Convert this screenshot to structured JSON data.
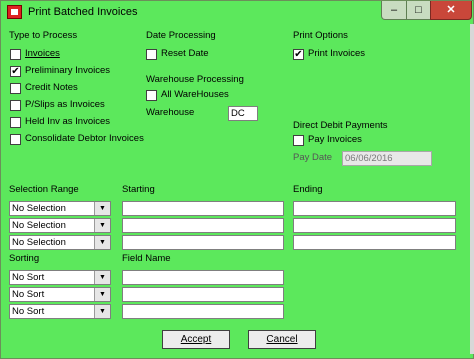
{
  "window": {
    "title": "Print Batched Invoices",
    "minimize_glyph": "–",
    "maximize_glyph": "□",
    "close_glyph": "✕"
  },
  "type_to_process": {
    "header": "Type to Process",
    "items": [
      {
        "label": "Invoices",
        "checked": false
      },
      {
        "label": "Preliminary Invoices",
        "checked": true
      },
      {
        "label": "Credit Notes",
        "checked": false
      },
      {
        "label": "P/Slips as Invoices",
        "checked": false
      },
      {
        "label": "Held Inv as Invoices",
        "checked": false
      },
      {
        "label": "Consolidate Debtor Invoices",
        "checked": false
      }
    ]
  },
  "date_processing": {
    "header": "Date Processing",
    "reset_date": {
      "label": "Reset Date",
      "checked": false
    }
  },
  "warehouse_processing": {
    "header": "Warehouse Processing",
    "all_warehouses": {
      "label": "All WareHouses",
      "checked": false
    },
    "warehouse_label": "Warehouse",
    "warehouse_value": "DC"
  },
  "print_options": {
    "header": "Print Options",
    "print_invoices": {
      "label": "Print Invoices",
      "checked": true
    }
  },
  "direct_debit": {
    "header": "Direct Debit Payments",
    "pay_invoices": {
      "label": "Pay Invoices",
      "checked": false
    },
    "pay_date_label": "Pay Date",
    "pay_date_value": "06/06/2016"
  },
  "selection": {
    "range_header": "Selection Range",
    "starting_header": "Starting",
    "ending_header": "Ending",
    "rows": [
      {
        "range": "No Selection",
        "starting": "",
        "ending": ""
      },
      {
        "range": "No Selection",
        "starting": "",
        "ending": ""
      },
      {
        "range": "No Selection",
        "starting": "",
        "ending": ""
      }
    ]
  },
  "sorting": {
    "header": "Sorting",
    "field_name_header": "Field Name",
    "rows": [
      {
        "sort": "No Sort",
        "field": ""
      },
      {
        "sort": "No Sort",
        "field": ""
      },
      {
        "sort": "No Sort",
        "field": ""
      }
    ]
  },
  "buttons": {
    "accept": "Accept",
    "cancel": "Cancel"
  },
  "icons": {
    "checkmark_glyph": "✔",
    "dropdown_glyph": "▼"
  }
}
